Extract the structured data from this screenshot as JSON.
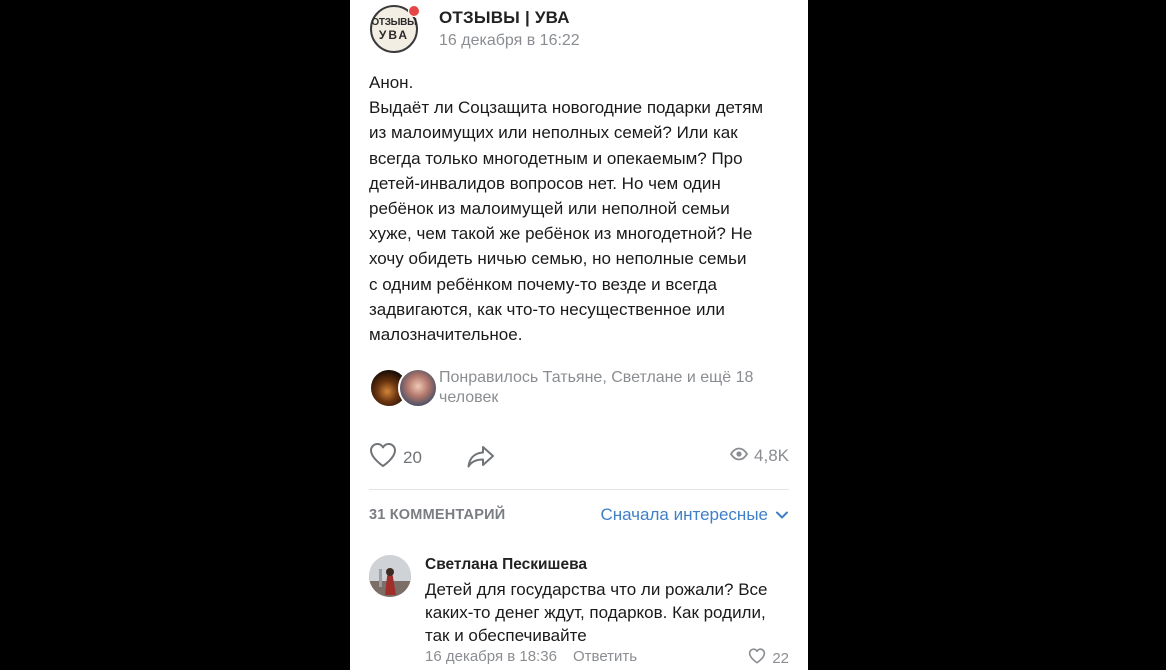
{
  "post": {
    "group_name": "ОТЗЫВЫ | УВА",
    "group_avatar_text": [
      "ОТЗЫВЫ",
      "УВА"
    ],
    "date": "16 декабря в 16:22",
    "text_lines": [
      "Анон.",
      "Выдаёт ли Соцзащита новогодние подарки детям",
      "из малоимущих или неполных семей? Или как",
      "всегда только многодетным и опекаемым? Про",
      "детей-инвалидов вопросов нет. Но чем один",
      "ребёнок из малоимущей или неполной семьи",
      "хуже, чем такой же ребёнок из многодетной? Не",
      "хочу обидеть ничью семью, но неполные семьи",
      "с одним ребёнком почему-то везде и всегда",
      "задвигаются, как что-то несущественное или",
      "малозначительное."
    ],
    "likes_text_lines": [
      "Понравилось Татьяне, Светлане и ещё 18",
      "человек"
    ],
    "like_count": "20",
    "views_count": "4,8K"
  },
  "comments": {
    "count_label": "31 КОММЕНТАРИЙ",
    "sort_label": "Сначала интересные"
  },
  "comment": {
    "author": "Светлана Пескишева",
    "text_lines": [
      "Детей для государства что ли рожали? Все",
      "каких-то денег ждут, подарков. Как родили,",
      "так и обеспечивайте"
    ],
    "date": "16 декабря в 18:36",
    "reply_label": "Ответить",
    "like_count": "22"
  },
  "colors": {
    "background": "#000000",
    "card": "#ffffff",
    "accent_link": "#3f7fc8",
    "secondary_text": "#8a8d91",
    "notification": "#e64646"
  },
  "icons": [
    "heart-icon",
    "share-icon",
    "eye-icon",
    "chevron-down-icon"
  ]
}
